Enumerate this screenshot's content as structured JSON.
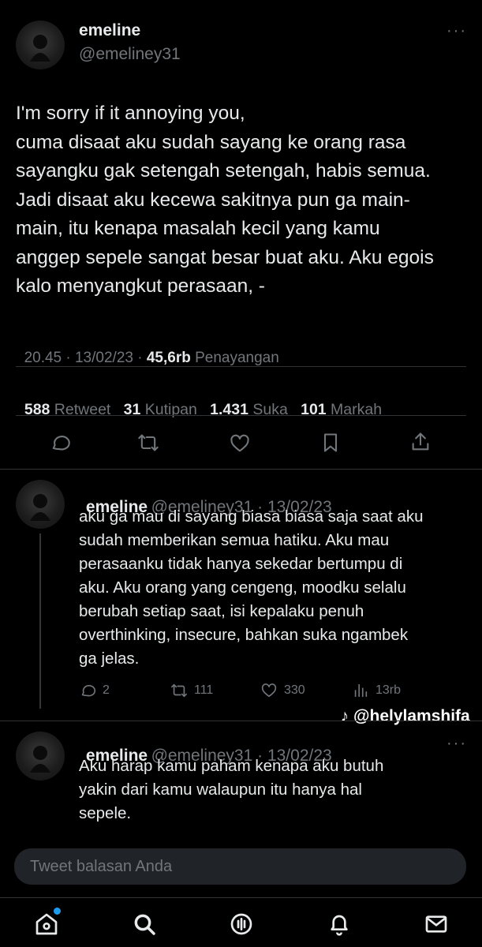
{
  "main_tweet": {
    "name": "emeline",
    "handle": "@emeliney31",
    "text": "I'm sorry if it annoying you,\ncuma disaat aku sudah sayang ke orang rasa\nsayangku gak setengah setengah, habis semua.\nJadi disaat aku kecewa sakitnya pun ga main-\nmain, itu kenapa masalah kecil yang kamu\nanggep sepele sangat besar buat aku. Aku egois\nkalo menyangkut perasaan, -",
    "time": "20.45 · 13/02/23 · ",
    "views_count": "45,6rb",
    "views_label": " Penayangan",
    "retweets": "588",
    "retweets_label": " Retweet",
    "quotes": "31",
    "quotes_label": " Kutipan",
    "likes": "1.431",
    "likes_label": " Suka",
    "bookmarks": "101",
    "bookmarks_label": " Markah"
  },
  "replies": [
    {
      "name": "emeline",
      "handle_date": "@emeliney31 · 13/02/23",
      "text": "aku ga mau di sayang biasa biasa saja saat aku\nsudah memberikan semua hatiku. Aku mau\nperasaanku tidak hanya sekedar bertumpu di\naku. Aku orang yang cengeng, moodku selalu\nberubah setiap saat, isi kepalaku penuh\noverthinking, insecure, bahkan suka ngambek\nga jelas.",
      "reply_count": "2",
      "retweet_count": "111",
      "like_count": "330",
      "views_count": "13rb"
    },
    {
      "name": "emeline",
      "handle_date": "@emeliney31 · 13/02/23",
      "text": "Aku harap kamu paham kenapa aku butuh\nyakin dari kamu walaupun itu hanya hal\nsepele."
    }
  ],
  "watermark": "@helylamshifa",
  "reply_input": {
    "placeholder": "Tweet balasan Anda"
  },
  "nav_icons": [
    "home-icon",
    "search-icon",
    "spaces-icon",
    "notifications-icon",
    "messages-icon"
  ],
  "colors": {
    "background": "#000000",
    "text": "#e7e9ea",
    "muted": "#71767b",
    "accent": "#1d9bf0"
  }
}
